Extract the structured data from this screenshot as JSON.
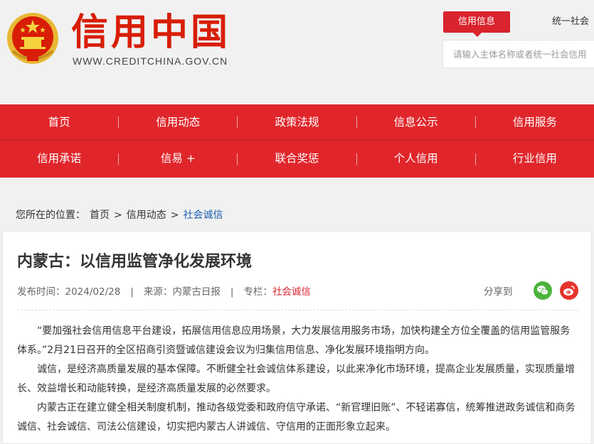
{
  "header": {
    "logo_title": "信用中国",
    "logo_url": "WWW.CREDITCHINA.GOV.CN",
    "search_tab_active": "信用信息",
    "search_tab_other": "统一社会",
    "search_placeholder": "请输入主体名称或者统一社会信用"
  },
  "nav": {
    "row1": [
      "首页",
      "信用动态",
      "政策法规",
      "信息公示",
      "信用服务"
    ],
    "row2": [
      "信用承诺",
      "信易 +",
      "联合奖惩",
      "个人信用",
      "行业信用"
    ]
  },
  "breadcrumb": {
    "prefix": "您所在的位置：",
    "items": [
      "首页",
      ">",
      "信用动态",
      ">",
      "社会诚信"
    ]
  },
  "article": {
    "title": "内蒙古：以信用监管净化发展环境",
    "publish_time": "发布时间：2024/02/28",
    "source": "来源：内蒙古日报",
    "column_label": "专栏：",
    "column_value": "社会诚信",
    "share_label": "分享到",
    "paragraphs": [
      "“要加强社会信用信息平台建设，拓展信用信息应用场景，大力发展信用服务市场，加快构建全方位全覆盖的信用监管服务体系。”2月21日召开的全区招商引资暨诚信建设会议为归集信用信息、净化发展环境指明方向。",
      "诚信，是经济高质量发展的基本保障。不断健全社会诚信体系建设，以此来净化市场环境，提高企业发展质量，实现质量增长、效益增长和动能转换，是经济高质量发展的必然要求。",
      "内蒙古正在建立健全相关制度机制，推动各级党委和政府信守承诺、“新官理旧账”、不轻诺寡信，统筹推进政务诚信和商务诚信、社会诚信、司法公信建设，切实把内蒙古人讲诚信、守信用的正面形象立起来。"
    ]
  },
  "colors": {
    "brand_red": "#d81e06",
    "nav_red": "#e0262b",
    "link_blue": "#1a5ea8",
    "wechat_green": "#4db33d",
    "weibo_red": "#e5332a"
  }
}
